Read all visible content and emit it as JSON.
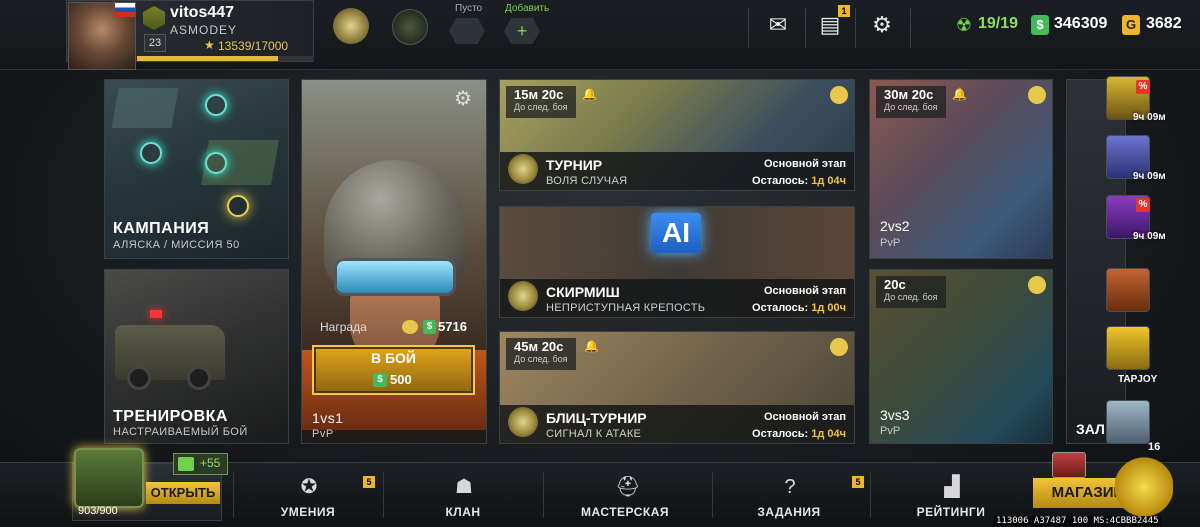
{
  "profile": {
    "nickname": "vitos447",
    "clan": "ASMODEY",
    "level": "23",
    "xp": "13539/17000",
    "xp_progress": 0.796
  },
  "header_slots": {
    "empty_label": "Пусто",
    "add_label": "Добавить"
  },
  "notifications": {
    "chat_badge": "1"
  },
  "resources": {
    "energy": "19/19",
    "cash": "346309",
    "cash_symbol": "$",
    "gold": "3682",
    "gold_symbol": "G"
  },
  "cards": {
    "campaign": {
      "title": "КАМПАНИЯ",
      "subtitle": "АЛЯСКА / МИССИЯ 50"
    },
    "training": {
      "title": "ТРЕНИРОВКА",
      "subtitle": "НАСТРАИВАЕМЫЙ БОЙ"
    },
    "pvp_1v1": {
      "reward_label": "Награда",
      "reward_value": "5716",
      "fight_label": "В БОЙ",
      "fight_cost": "500",
      "mode": "1vs1",
      "mode_sub": "PvP"
    },
    "tournament": {
      "timer": "15м 20с",
      "timer_note": "До след. боя",
      "title": "ТУРНИР",
      "subtitle": "ВОЛЯ СЛУЧАЯ",
      "stage": "Основной этап",
      "left_label": "Осталось:",
      "left_value": "1д 04ч"
    },
    "skirmish": {
      "ai_label": "AI",
      "title": "СКИРМИШ",
      "subtitle": "НЕПРИСТУПНАЯ КРЕПОСТЬ",
      "stage": "Основной этап",
      "left_label": "Осталось:",
      "left_value": "1д 00ч"
    },
    "blitz": {
      "timer": "45м 20с",
      "timer_note": "До след. боя",
      "title": "БЛИЦ-ТУРНИР",
      "subtitle": "СИГНАЛ К АТАКЕ",
      "stage": "Основной этап",
      "left_label": "Осталось:",
      "left_value": "1д 04ч"
    },
    "pvp_2v2": {
      "timer": "30м 20с",
      "timer_note": "До след. боя",
      "mode": "2vs2",
      "mode_sub": "PvP"
    },
    "pvp_3v3": {
      "timer": "20с",
      "timer_note": "До след. боя",
      "mode": "3vs3",
      "mode_sub": "PvP"
    },
    "hall": {
      "title": "ЗАЛ С"
    }
  },
  "shop_side": {
    "offer1_time": "9ч 09м",
    "offer2_time": "9ч 09м",
    "offer3_time": "9ч 09м",
    "pct": "%",
    "tapjoy": "TAPJOY",
    "box_count": "16"
  },
  "bottom": {
    "open_label": "ОТКРЫТЬ",
    "chest_count": "903/900",
    "plus_value": "+55",
    "nav": [
      {
        "label": "УМЕНИЯ",
        "badge": "5"
      },
      {
        "label": "КЛАН",
        "badge": ""
      },
      {
        "label": "МАСТЕРСКАЯ",
        "badge": ""
      },
      {
        "label": "ЗАДАНИЯ",
        "badge": "5"
      },
      {
        "label": "РЕЙТИНГИ",
        "badge": ""
      }
    ],
    "shop_label": "МАГАЗИН"
  },
  "debug_text": "113006 A37487 100 MS:4CBBB2445",
  "colors": {
    "accent_gold": "#f2c43a",
    "cash_green": "#45b85b",
    "energy_green": "#8ae05a"
  }
}
